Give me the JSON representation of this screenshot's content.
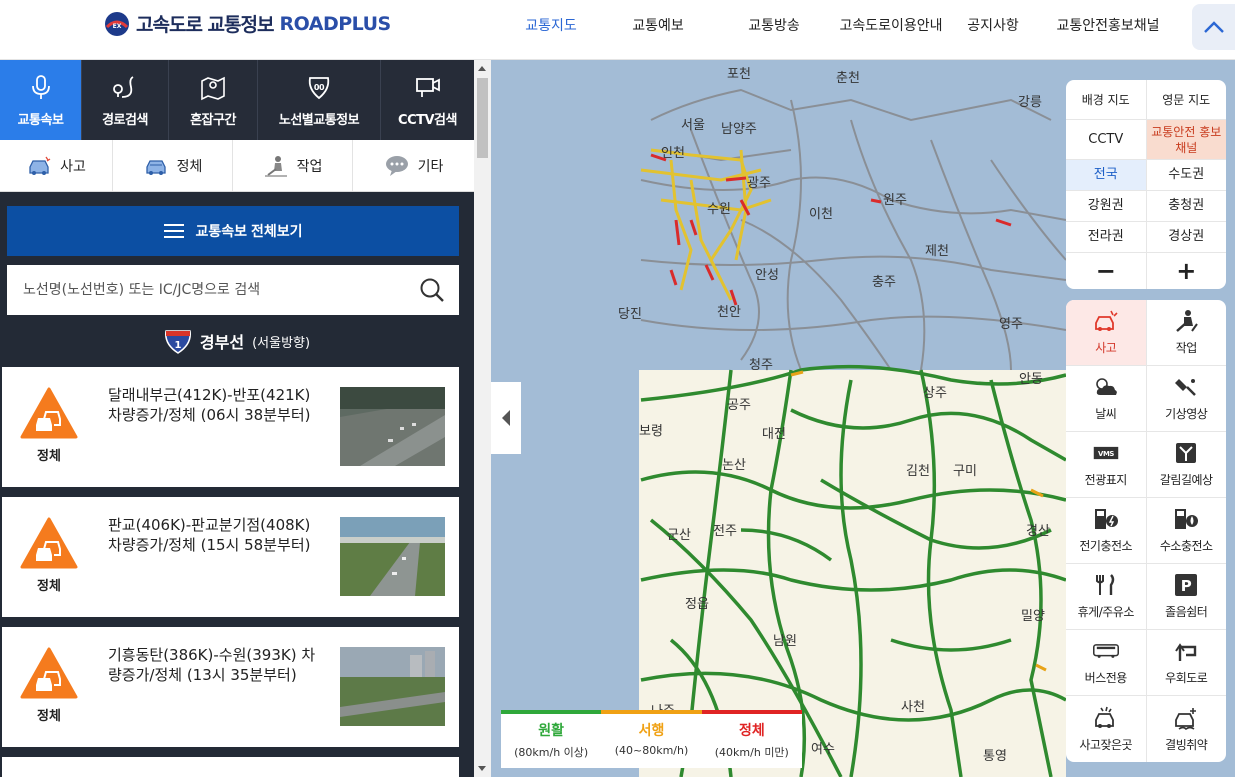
{
  "header": {
    "logo_kr": "고속도로 교통정보",
    "logo_en": "ROADPLUS",
    "nav": [
      "교통지도",
      "교통예보",
      "교통방송",
      "고속도로이용안내",
      "공지사항",
      "교통안전홍보채널"
    ]
  },
  "tabs": [
    "교통속보",
    "경로검색",
    "혼잡구간",
    "노선별교통정보",
    "CCTV검색"
  ],
  "categories": [
    "사고",
    "정체",
    "작업",
    "기타"
  ],
  "all_button": "교통속보 전체보기",
  "search": {
    "placeholder": "노선명(노선번호) 또는 IC/JC명으로 검색"
  },
  "route": {
    "number": "1",
    "name": "경부선",
    "direction": "(서울방향)"
  },
  "incidents": [
    {
      "type": "정체",
      "text": "달래내부근(412K)-반포(421K) 차량증가/정체 (06시 38분부터)"
    },
    {
      "type": "정체",
      "text": "판교(406K)-판교분기점(408K) 차량증가/정체 (15시 58분부터)"
    },
    {
      "type": "정체",
      "text": "기흥동탄(386K)-수원(393K) 차량증가/정체 (13시 35분부터)"
    }
  ],
  "map": {
    "cities": [
      "포천",
      "춘천",
      "강릉",
      "서울",
      "남양주",
      "인천",
      "광주",
      "원주",
      "이천",
      "수원",
      "제천",
      "충주",
      "안성",
      "당진",
      "천안",
      "영주",
      "청주",
      "상주",
      "안동",
      "보령",
      "공주",
      "대전",
      "논산",
      "김천",
      "구미",
      "군산",
      "전주",
      "경산",
      "정읍",
      "밀양",
      "남원",
      "사천",
      "통영",
      "여수",
      "나주"
    ],
    "legend": [
      {
        "label": "원활",
        "range": "(80km/h 이상)",
        "color": "#2fa83a"
      },
      {
        "label": "서행",
        "range": "(40~80km/h)",
        "color": "#f0a114"
      },
      {
        "label": "정체",
        "range": "(40km/h 미만)",
        "color": "#e02424"
      }
    ]
  },
  "map_controls": {
    "base_map": "배경 지도",
    "english_map": "영문 지도",
    "cctv": "CCTV",
    "safety_channel": "교통안전 홍보채널",
    "regions": [
      "전국",
      "수도권",
      "강원권",
      "충청권",
      "전라권",
      "경상권"
    ],
    "zoom_out": "−",
    "zoom_in": "+"
  },
  "layers": [
    "사고",
    "작업",
    "날씨",
    "기상영상",
    "전광표지",
    "갈림길예상",
    "전기충전소",
    "수소충전소",
    "휴게/주유소",
    "졸음쉼터",
    "버스전용",
    "우회도로",
    "사고잦은곳",
    "결빙취약"
  ],
  "layer_icons": [
    "car-crash-icon",
    "worker-icon",
    "weather-icon",
    "weather-video-icon",
    "vms-icon",
    "junction-icon",
    "ev-charger-icon",
    "hydrogen-station-icon",
    "rest-area-icon",
    "parking-icon",
    "bus-lane-icon",
    "detour-icon",
    "frequent-accident-icon",
    "ice-road-icon"
  ]
}
